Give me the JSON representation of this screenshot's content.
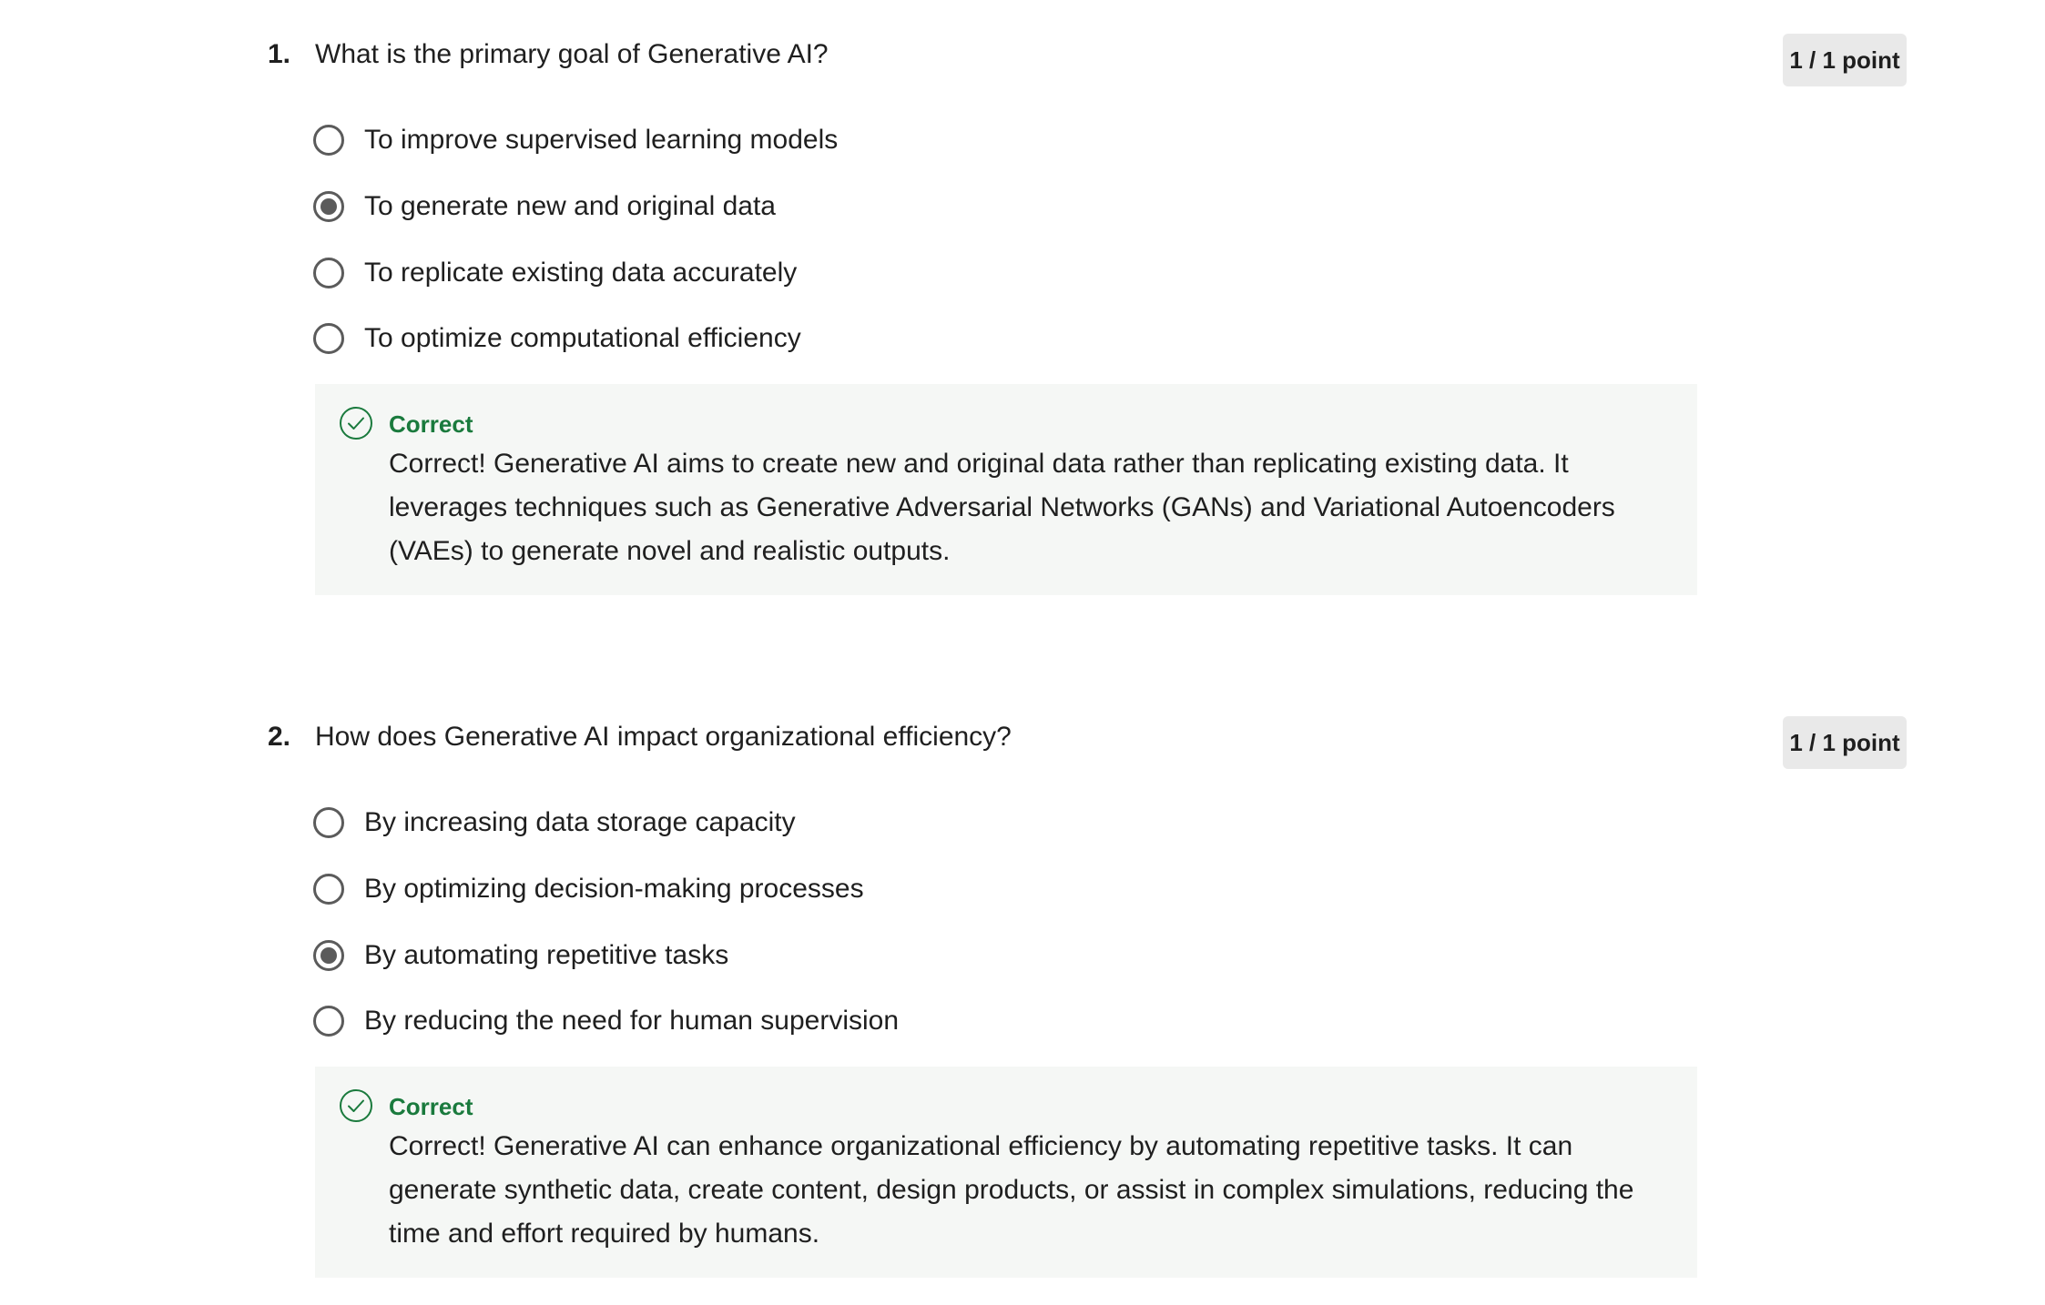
{
  "questions": [
    {
      "number": "1.",
      "text": "What is the primary goal of Generative AI?",
      "points": "1 / 1 point",
      "options": [
        {
          "label": "To improve supervised learning models",
          "selected": false
        },
        {
          "label": "To generate new and original data",
          "selected": true
        },
        {
          "label": "To replicate existing data accurately",
          "selected": false
        },
        {
          "label": "To optimize computational efficiency",
          "selected": false
        }
      ],
      "feedback": {
        "status": "Correct",
        "icon": "check-circle-icon",
        "text": "Correct! Generative AI aims to create new and original data rather than replicating existing data. It leverages techniques such as Generative Adversarial Networks (GANs) and Variational Autoencoders (VAEs) to generate novel and realistic outputs."
      }
    },
    {
      "number": "2.",
      "text": "How does Generative AI impact organizational efficiency?",
      "points": "1 / 1 point",
      "options": [
        {
          "label": "By increasing data storage capacity",
          "selected": false
        },
        {
          "label": "By optimizing decision-making processes",
          "selected": false
        },
        {
          "label": "By automating repetitive tasks",
          "selected": true
        },
        {
          "label": "By reducing the need for human supervision",
          "selected": false
        }
      ],
      "feedback": {
        "status": "Correct",
        "icon": "check-circle-icon",
        "text": "Correct! Generative AI can enhance organizational efficiency by automating repetitive tasks. It can generate synthetic data, create content, design products, or assist in complex simulations, reducing the time and effort required by humans."
      }
    }
  ],
  "colors": {
    "correct": "#1a7a3d",
    "badge_bg": "#e9e9e9",
    "feedback_bg": "#f5f7f5",
    "radio": "#5b5b5b"
  }
}
